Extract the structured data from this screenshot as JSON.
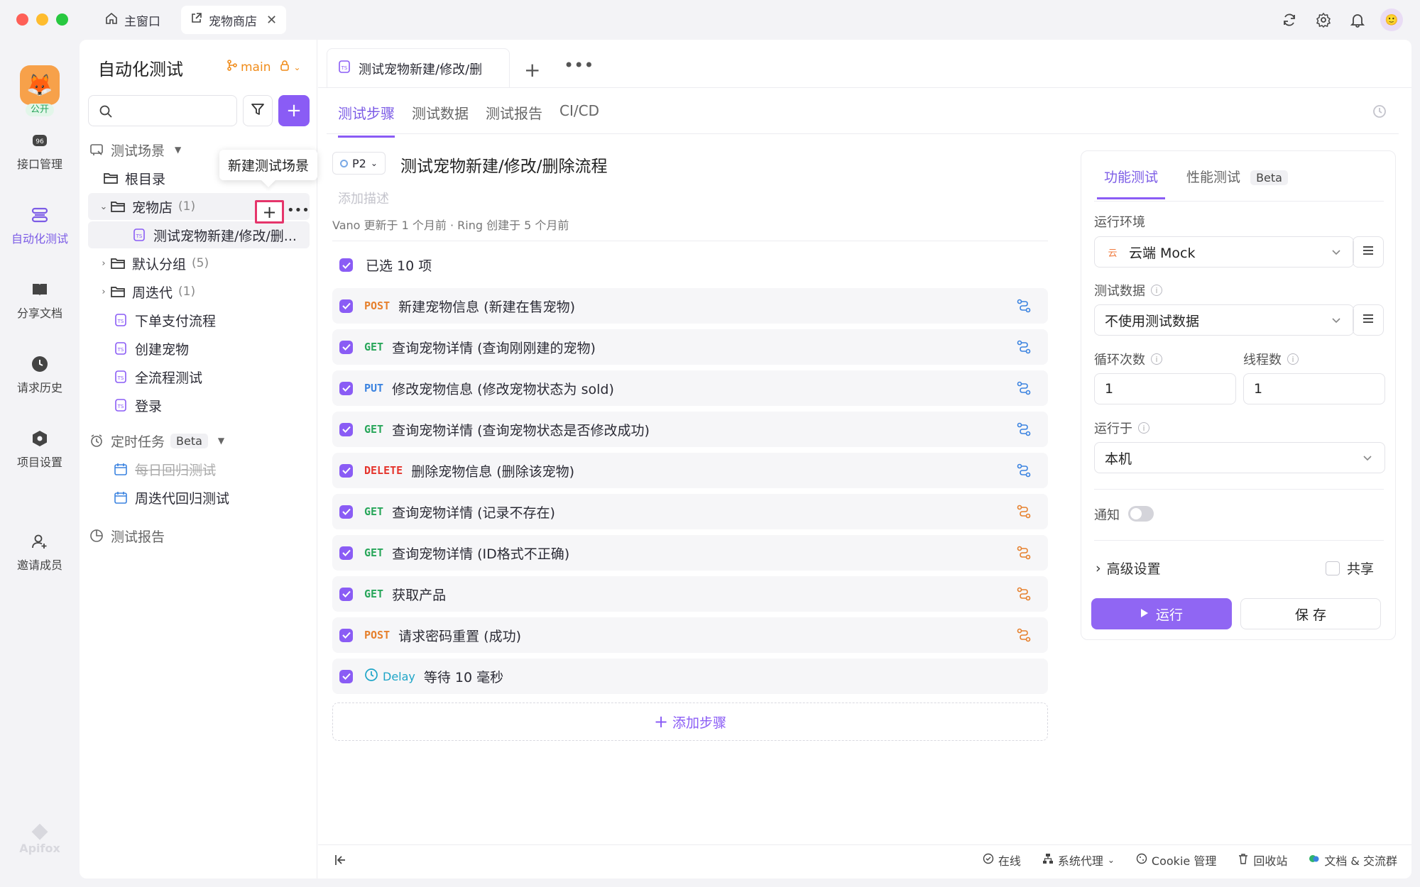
{
  "window": {
    "tabs": [
      {
        "label": "主窗口",
        "icon": "home-icon"
      },
      {
        "label": "宠物商店",
        "icon": "external-link-icon"
      }
    ]
  },
  "rail": {
    "app_badge": "公开",
    "brand": "Apifox",
    "items": [
      {
        "label": "接口管理",
        "icon": "api-icon"
      },
      {
        "label": "自动化测试",
        "icon": "layers-icon",
        "active": true
      },
      {
        "label": "分享文档",
        "icon": "book-icon"
      },
      {
        "label": "请求历史",
        "icon": "clock-icon"
      },
      {
        "label": "项目设置",
        "icon": "hexagon-icon"
      },
      {
        "label": "邀请成员",
        "icon": "user-plus-icon"
      }
    ]
  },
  "sidebar": {
    "title": "自动化测试",
    "branch": "main",
    "search_placeholder": "",
    "tooltip": "新建测试场景",
    "tree": {
      "scenes_header": "测试场景",
      "root": "根目录",
      "petshop": {
        "label": "宠物店",
        "count": "(1)"
      },
      "petshop_child": "测试宠物新建/修改/删...",
      "default_group": {
        "label": "默认分组",
        "count": "(5)"
      },
      "weekly": {
        "label": "周迭代",
        "count": "(1)"
      },
      "items": [
        "下单支付流程",
        "创建宠物",
        "全流程测试",
        "登录"
      ],
      "scheduled_header": "定时任务",
      "scheduled_beta": "Beta",
      "scheduled_items": [
        "每日回归测试",
        "周迭代回归测试"
      ],
      "reports": "测试报告"
    }
  },
  "editor": {
    "doc_tab": "测试宠物新建/修改/删",
    "subtabs": [
      "测试步骤",
      "测试数据",
      "测试报告",
      "CI/CD"
    ],
    "priority": "P2",
    "case_title": "测试宠物新建/修改/删除流程",
    "add_desc": "添加描述",
    "meta": "Vano 更新于 1 个月前 · Ring 创建于 5 个月前",
    "selected": "已选 10 项",
    "steps": [
      {
        "method": "POST",
        "name": "新建宠物信息 (新建在售宠物)",
        "link": "blue"
      },
      {
        "method": "GET",
        "name": "查询宠物详情 (查询刚刚建的宠物)",
        "link": "blue"
      },
      {
        "method": "PUT",
        "name": "修改宠物信息 (修改宠物状态为 sold)",
        "link": "blue"
      },
      {
        "method": "GET",
        "name": "查询宠物详情 (查询宠物状态是否修改成功)",
        "link": "blue"
      },
      {
        "method": "DELETE",
        "name": "删除宠物信息 (删除该宠物)",
        "link": "blue"
      },
      {
        "method": "GET",
        "name": "查询宠物详情 (记录不存在)",
        "link": "orange"
      },
      {
        "method": "GET",
        "name": "查询宠物详情 (ID格式不正确)",
        "link": "orange"
      },
      {
        "method": "GET",
        "name": "获取产品",
        "link": "orange"
      },
      {
        "method": "POST",
        "name": "请求密码重置 (成功)",
        "link": "orange"
      },
      {
        "method": "Delay",
        "name": "等待 10 毫秒",
        "link": "none"
      }
    ],
    "add_step": "添加步骤"
  },
  "run_panel": {
    "tabs": [
      "功能测试",
      "性能测试"
    ],
    "perf_beta": "Beta",
    "env_label": "运行环境",
    "env_icon_text": "云",
    "env_value": "云端 Mock",
    "data_label": "测试数据",
    "data_value": "不使用测试数据",
    "loops_label": "循环次数",
    "loops_value": "1",
    "threads_label": "线程数",
    "threads_value": "1",
    "run_on_label": "运行于",
    "run_on_value": "本机",
    "notify_label": "通知",
    "advanced": "高级设置",
    "share": "共享",
    "run": "运行",
    "save": "保 存"
  },
  "statusbar": [
    "在线",
    "系统代理",
    "Cookie 管理",
    "回收站",
    "文档 & 交流群"
  ],
  "colors": {
    "accent": "#8a5cf5",
    "post": "#e6802d",
    "get": "#28a65a",
    "put": "#3b83e0",
    "delete": "#e5352d",
    "delay": "#1ea5c7"
  }
}
